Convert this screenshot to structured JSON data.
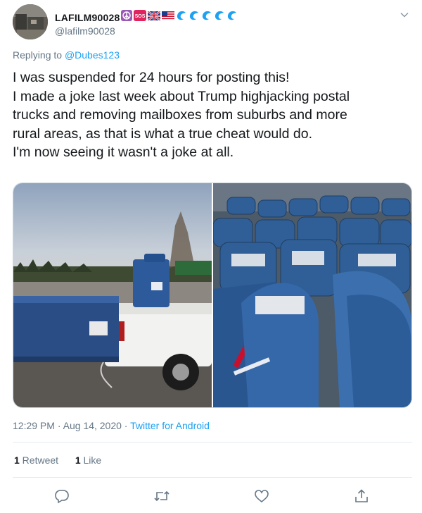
{
  "tweet": {
    "display_name": "LAFILM90028",
    "handle": "@lafilm90028",
    "reply_prefix": "Replying to ",
    "reply_to": "@Dubes123",
    "lines": [
      "I was suspended for 24 hours for posting this!",
      "I made a joke last week about Trump highjacking postal",
      "trucks and removing mailboxes from suburbs and more",
      "rural areas, as that is what a true cheat would do.",
      "I'm now seeing it wasn't a joke at all."
    ],
    "time": "12:29 PM",
    "dot1": " · ",
    "date": "Aug 14, 2020",
    "dot2": " · ",
    "source": "Twitter for Android",
    "retweets_count": "1",
    "retweets_label": " Retweet",
    "likes_count": "1",
    "likes_label": " Like",
    "sos_badge": "SOS",
    "badge_icons": [
      "peace-icon",
      "sos-icon",
      "uk-flag-icon",
      "us-flag-icon",
      "wave-icon",
      "wave-icon",
      "wave-icon",
      "wave-icon",
      "wave-icon"
    ],
    "colors": {
      "link": "#1da1f2",
      "secondary": "#657786",
      "text": "#14171a",
      "border": "#ccd6dd"
    }
  }
}
